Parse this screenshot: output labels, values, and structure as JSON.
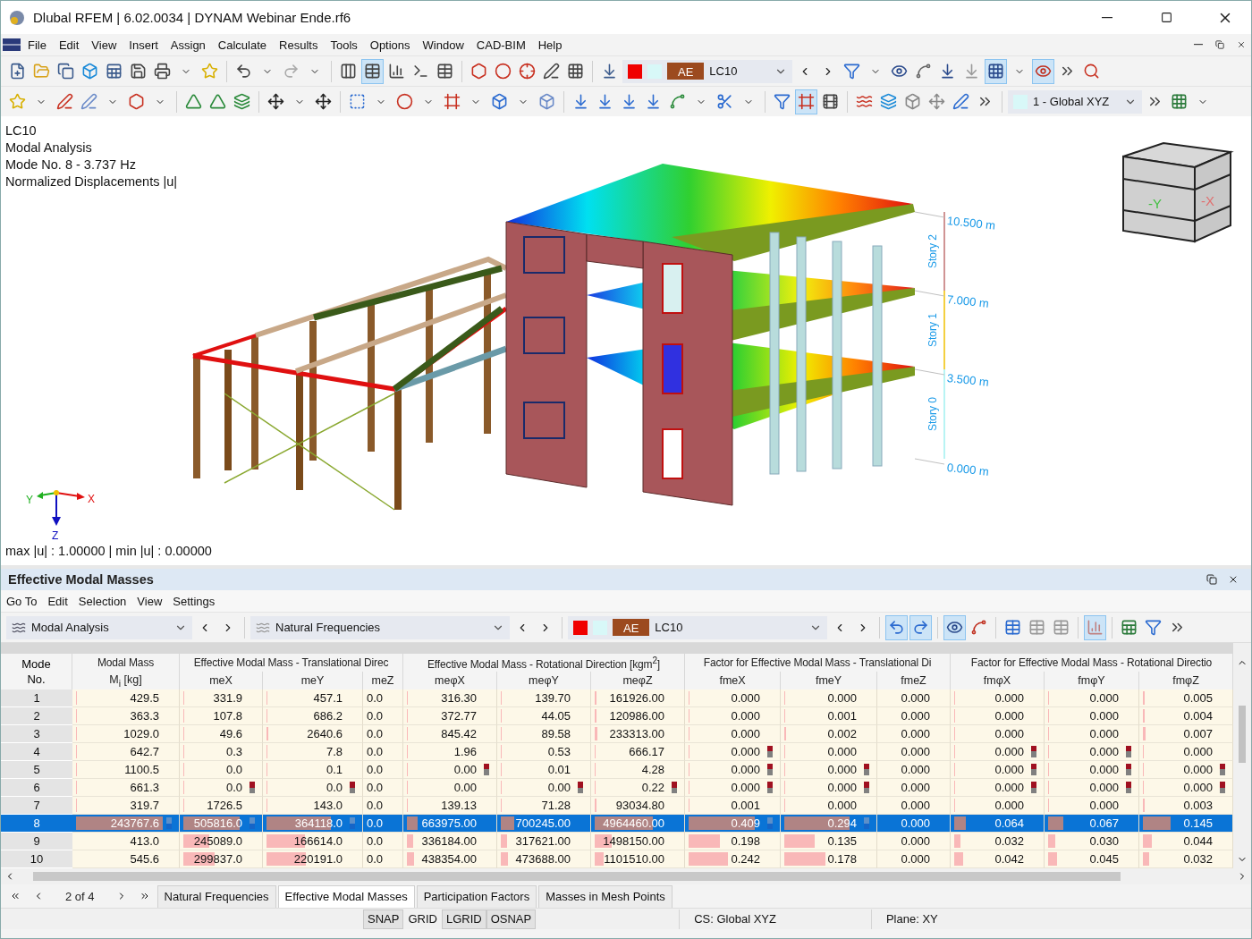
{
  "window": {
    "title": "Dlubal RFEM | 6.02.0034 | DYNAM Webinar Ende.rf6"
  },
  "menu": [
    "File",
    "Edit",
    "View",
    "Insert",
    "Assign",
    "Calculate",
    "Results",
    "Tools",
    "Options",
    "Window",
    "CAD-BIM",
    "Help"
  ],
  "toolbar": {
    "load_case": {
      "tag": "AE",
      "name": "LC10"
    },
    "coordinate_system": "1 - Global XYZ"
  },
  "viewport": {
    "info_lines": [
      "LC10",
      "Modal Analysis",
      "Mode No. 8 - 3.737 Hz",
      "Normalized Displacements |u|"
    ],
    "levels": [
      "10.500 m",
      "7.000 m",
      "3.500 m",
      "0.000 m"
    ],
    "stories": [
      "Story 2",
      "Story 1",
      "Story 0"
    ],
    "view_cube": {
      "front": "-Y",
      "side": "-X"
    },
    "axes": {
      "x": "X",
      "y": "Y",
      "z": "Z"
    },
    "footer": "max |u| : 1.00000 | min |u| : 0.00000"
  },
  "panel": {
    "title": "Effective Modal Masses",
    "menu": [
      "Go To",
      "Edit",
      "Selection",
      "View",
      "Settings"
    ],
    "analysis_select": "Modal Analysis",
    "result_select": "Natural Frequencies",
    "load_case": {
      "tag": "AE",
      "name": "LC10"
    },
    "table": {
      "mode_header": [
        "Mode",
        "No."
      ],
      "groups": [
        "Modal Mass",
        "Effective Modal Mass - Translational Direc",
        "Effective Modal Mass - Rotational Direction [kgm$^{2}$]",
        "Factor for Effective Modal Mass - Translational Di",
        "Factor for Effective Modal Mass - Rotational Directio"
      ],
      "columns": [
        "M$_{i}$ [kg]",
        "meX",
        "meY",
        "meZ",
        "meφX",
        "meφY",
        "meφZ",
        "fmeX",
        "fmeY",
        "fmeZ",
        "fmφX",
        "fmφY",
        "fmφZ"
      ],
      "rows": [
        {
          "no": "1",
          "selected": false,
          "cells": [
            {
              "v": "429.5",
              "level": 0.01,
              "flag": false
            },
            {
              "v": "331.9",
              "level": 0.01,
              "flag": false
            },
            {
              "v": "457.1",
              "level": 0.01,
              "flag": false
            },
            {
              "v": "0.0",
              "flag": false
            },
            {
              "v": "316.30",
              "level": 0.01,
              "flag": false
            },
            {
              "v": "139.70",
              "level": 0.01,
              "flag": false
            },
            {
              "v": "161926.00",
              "level": 0.02,
              "flag": false
            },
            {
              "v": "0.000",
              "level": 0.01,
              "flag": false
            },
            {
              "v": "0.000",
              "level": 0.01,
              "flag": false
            },
            {
              "v": "0.000",
              "flag": false
            },
            {
              "v": "0.000",
              "level": 0.01,
              "flag": false
            },
            {
              "v": "0.000",
              "level": 0.01,
              "flag": false
            },
            {
              "v": "0.005",
              "level": 0.02,
              "flag": false
            }
          ]
        },
        {
          "no": "2",
          "selected": false,
          "cells": [
            {
              "v": "363.3",
              "level": 0.01,
              "flag": false
            },
            {
              "v": "107.8",
              "level": 0.01,
              "flag": false
            },
            {
              "v": "686.2",
              "level": 0.01,
              "flag": false
            },
            {
              "v": "0.0",
              "flag": false
            },
            {
              "v": "372.77",
              "level": 0.01,
              "flag": false
            },
            {
              "v": "44.05",
              "level": 0.01,
              "flag": false
            },
            {
              "v": "120986.00",
              "level": 0.02,
              "flag": false
            },
            {
              "v": "0.000",
              "level": 0.01,
              "flag": false
            },
            {
              "v": "0.001",
              "level": 0.01,
              "flag": false
            },
            {
              "v": "0.000",
              "flag": false
            },
            {
              "v": "0.000",
              "level": 0.01,
              "flag": false
            },
            {
              "v": "0.000",
              "level": 0.01,
              "flag": false
            },
            {
              "v": "0.004",
              "level": 0.02,
              "flag": false
            }
          ]
        },
        {
          "no": "3",
          "selected": false,
          "cells": [
            {
              "v": "1029.0",
              "level": 0.01,
              "flag": false
            },
            {
              "v": "49.6",
              "level": 0.01,
              "flag": false
            },
            {
              "v": "2640.6",
              "level": 0.02,
              "flag": false
            },
            {
              "v": "0.0",
              "flag": false
            },
            {
              "v": "845.42",
              "level": 0.01,
              "flag": false
            },
            {
              "v": "89.58",
              "level": 0.01,
              "flag": false
            },
            {
              "v": "233313.00",
              "level": 0.03,
              "flag": false
            },
            {
              "v": "0.000",
              "level": 0.01,
              "flag": false
            },
            {
              "v": "0.002",
              "level": 0.02,
              "flag": false
            },
            {
              "v": "0.000",
              "flag": false
            },
            {
              "v": "0.000",
              "level": 0.01,
              "flag": false
            },
            {
              "v": "0.000",
              "level": 0.01,
              "flag": false
            },
            {
              "v": "0.007",
              "level": 0.03,
              "flag": false
            }
          ]
        },
        {
          "no": "4",
          "selected": false,
          "cells": [
            {
              "v": "642.7",
              "level": 0.01,
              "flag": false
            },
            {
              "v": "0.3",
              "level": 0.01,
              "flag": false
            },
            {
              "v": "7.8",
              "level": 0.01,
              "flag": false
            },
            {
              "v": "0.0",
              "flag": false
            },
            {
              "v": "1.96",
              "level": 0.01,
              "flag": false
            },
            {
              "v": "0.53",
              "level": 0.01,
              "flag": false
            },
            {
              "v": "666.17",
              "level": 0.01,
              "flag": false
            },
            {
              "v": "0.000",
              "level": 0.01,
              "flag": true
            },
            {
              "v": "0.000",
              "level": 0.01,
              "flag": false
            },
            {
              "v": "0.000",
              "flag": false
            },
            {
              "v": "0.000",
              "level": 0.01,
              "flag": true
            },
            {
              "v": "0.000",
              "level": 0.01,
              "flag": true
            },
            {
              "v": "0.000",
              "level": 0.01,
              "flag": false
            }
          ]
        },
        {
          "no": "5",
          "selected": false,
          "cells": [
            {
              "v": "1100.5",
              "level": 0.01,
              "flag": false
            },
            {
              "v": "0.0",
              "level": 0.01,
              "flag": false
            },
            {
              "v": "0.1",
              "level": 0.01,
              "flag": false
            },
            {
              "v": "0.0",
              "flag": false
            },
            {
              "v": "0.00",
              "level": 0.01,
              "flag": true
            },
            {
              "v": "0.01",
              "level": 0.01,
              "flag": false
            },
            {
              "v": "4.28",
              "level": 0.01,
              "flag": false
            },
            {
              "v": "0.000",
              "level": 0.01,
              "flag": true
            },
            {
              "v": "0.000",
              "level": 0.01,
              "flag": true
            },
            {
              "v": "0.000",
              "flag": false
            },
            {
              "v": "0.000",
              "level": 0.01,
              "flag": true
            },
            {
              "v": "0.000",
              "level": 0.01,
              "flag": true
            },
            {
              "v": "0.000",
              "level": 0.01,
              "flag": true
            }
          ]
        },
        {
          "no": "6",
          "selected": false,
          "cells": [
            {
              "v": "661.3",
              "level": 0.01,
              "flag": false
            },
            {
              "v": "0.0",
              "level": 0.01,
              "flag": true
            },
            {
              "v": "0.0",
              "level": 0.01,
              "flag": true
            },
            {
              "v": "0.0",
              "flag": false
            },
            {
              "v": "0.00",
              "level": 0.01,
              "flag": false
            },
            {
              "v": "0.00",
              "level": 0.01,
              "flag": true
            },
            {
              "v": "0.22",
              "level": 0.01,
              "flag": true
            },
            {
              "v": "0.000",
              "level": 0.01,
              "flag": true
            },
            {
              "v": "0.000",
              "level": 0.01,
              "flag": true
            },
            {
              "v": "0.000",
              "flag": false
            },
            {
              "v": "0.000",
              "level": 0.01,
              "flag": true
            },
            {
              "v": "0.000",
              "level": 0.01,
              "flag": true
            },
            {
              "v": "0.000",
              "level": 0.01,
              "flag": true
            }
          ]
        },
        {
          "no": "7",
          "selected": false,
          "cells": [
            {
              "v": "319.7",
              "level": 0.01,
              "flag": false
            },
            {
              "v": "1726.5",
              "level": 0.01,
              "flag": false
            },
            {
              "v": "143.0",
              "level": 0.01,
              "flag": false
            },
            {
              "v": "0.0",
              "flag": false
            },
            {
              "v": "139.13",
              "level": 0.01,
              "flag": false
            },
            {
              "v": "71.28",
              "level": 0.01,
              "flag": false
            },
            {
              "v": "93034.80",
              "level": 0.02,
              "flag": false
            },
            {
              "v": "0.001",
              "level": 0.01,
              "flag": false
            },
            {
              "v": "0.000",
              "level": 0.01,
              "flag": false
            },
            {
              "v": "0.000",
              "flag": false
            },
            {
              "v": "0.000",
              "level": 0.01,
              "flag": false
            },
            {
              "v": "0.000",
              "level": 0.01,
              "flag": false
            },
            {
              "v": "0.003",
              "level": 0.02,
              "flag": false
            }
          ]
        },
        {
          "no": "8",
          "selected": true,
          "cells": [
            {
              "v": "243767.6",
              "level": 0.87,
              "flag": true
            },
            {
              "v": "505816.0",
              "level": 0.75,
              "flag": true
            },
            {
              "v": "364118.0",
              "level": 0.7,
              "flag": true
            },
            {
              "v": "0.0",
              "flag": false
            },
            {
              "v": "663975.00",
              "level": 0.13,
              "flag": false
            },
            {
              "v": "700245.00",
              "level": 0.16,
              "flag": false
            },
            {
              "v": "4964460.00",
              "level": 0.68,
              "flag": false
            },
            {
              "v": "0.409",
              "level": 0.75,
              "flag": true
            },
            {
              "v": "0.294",
              "level": 0.74,
              "flag": true
            },
            {
              "v": "0.000",
              "flag": false
            },
            {
              "v": "0.064",
              "level": 0.14,
              "flag": false
            },
            {
              "v": "0.067",
              "level": 0.18,
              "flag": false
            },
            {
              "v": "0.145",
              "level": 0.32,
              "flag": false
            }
          ]
        },
        {
          "no": "9",
          "selected": false,
          "cells": [
            {
              "v": "413.0",
              "flag": false
            },
            {
              "v": "245089.0",
              "level": 0.34,
              "flag": false
            },
            {
              "v": "166614.0",
              "level": 0.42,
              "flag": false
            },
            {
              "v": "0.0",
              "flag": false
            },
            {
              "v": "336184.00",
              "level": 0.07,
              "flag": false
            },
            {
              "v": "317621.00",
              "level": 0.07,
              "flag": false
            },
            {
              "v": "1498150.00",
              "level": 0.2,
              "flag": false
            },
            {
              "v": "0.198",
              "level": 0.36,
              "flag": false
            },
            {
              "v": "0.135",
              "level": 0.34,
              "flag": false
            },
            {
              "v": "0.000",
              "flag": false
            },
            {
              "v": "0.032",
              "level": 0.07,
              "flag": false
            },
            {
              "v": "0.030",
              "level": 0.08,
              "flag": false
            },
            {
              "v": "0.044",
              "level": 0.1,
              "flag": false
            }
          ]
        },
        {
          "no": "10",
          "selected": false,
          "cells": [
            {
              "v": "545.6",
              "flag": false
            },
            {
              "v": "299837.0",
              "level": 0.42,
              "flag": false
            },
            {
              "v": "220191.0",
              "level": 0.43,
              "flag": false
            },
            {
              "v": "0.0",
              "flag": false
            },
            {
              "v": "438354.00",
              "level": 0.08,
              "flag": false
            },
            {
              "v": "473688.00",
              "level": 0.08,
              "flag": false
            },
            {
              "v": "1101510.00",
              "level": 0.1,
              "flag": false
            },
            {
              "v": "0.242",
              "level": 0.45,
              "flag": false
            },
            {
              "v": "0.178",
              "level": 0.46,
              "flag": false
            },
            {
              "v": "0.000",
              "flag": false
            },
            {
              "v": "0.042",
              "level": 0.1,
              "flag": false
            },
            {
              "v": "0.045",
              "level": 0.1,
              "flag": false
            },
            {
              "v": "0.032",
              "level": 0.07,
              "flag": false
            }
          ]
        }
      ]
    },
    "pager": "2 of 4",
    "tabs": [
      {
        "label": "Natural Frequencies",
        "selected": false
      },
      {
        "label": "Effective Modal Masses",
        "selected": true
      },
      {
        "label": "Participation Factors",
        "selected": false
      },
      {
        "label": "Masses in Mesh Points",
        "selected": false
      }
    ]
  },
  "status_bar": {
    "toggles": [
      {
        "label": "SNAP",
        "on": true
      },
      {
        "label": "GRID",
        "on": false
      },
      {
        "label": "LGRID",
        "on": true
      },
      {
        "label": "OSNAP",
        "on": true
      }
    ],
    "cs": "CS: Global XYZ",
    "plane": "Plane: XY"
  }
}
